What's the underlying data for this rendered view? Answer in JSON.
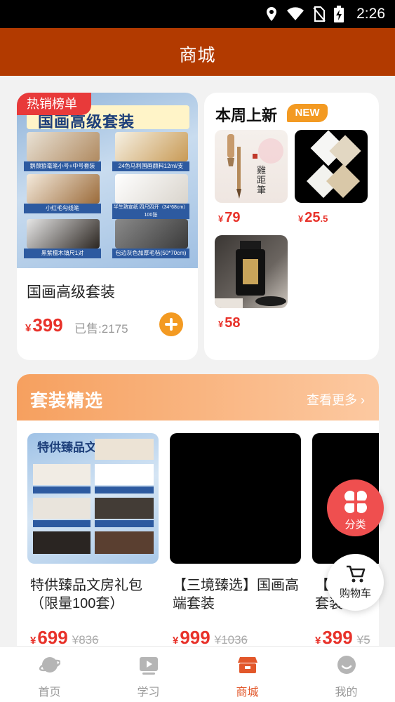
{
  "status_bar": {
    "time": "2:26"
  },
  "header": {
    "title": "商城"
  },
  "hot_card": {
    "badge": "热销榜单",
    "image_banner": "国画高级套装",
    "image_captions": [
      "鹅颈狼毫笔小号+中号套装",
      "24色马利国画颜料12ml/支",
      "小红毛勾线笔",
      "半生熟宣纸 四尺四开（34*68cm）100张",
      "黑紫檀木镇尺1对",
      "包边灰色加厚毛毡(50*70cm)"
    ],
    "name": "国画高级套装",
    "currency": "¥",
    "price": "399",
    "sold": "已售:2175"
  },
  "new_card": {
    "title": "本周上新",
    "badge": "NEW",
    "items": [
      {
        "currency": "¥",
        "price": "79",
        "decimal": ""
      },
      {
        "currency": "¥",
        "price": "25",
        "decimal": ".5"
      },
      {
        "currency": "¥",
        "price": "58",
        "decimal": ""
      }
    ]
  },
  "combo": {
    "title": "套装精选",
    "more": "查看更多",
    "products": [
      {
        "name": "特供臻品文房礼包（限量100套）",
        "currency": "¥",
        "price": "699",
        "original": "¥836",
        "image_title": "特供臻品文房礼包"
      },
      {
        "name": "【三境臻选】国画高端套装",
        "currency": "¥",
        "price": "999",
        "original": "¥1036"
      },
      {
        "name": "【",
        "name_line2": "套装",
        "currency": "¥",
        "price": "399",
        "original": "¥5"
      }
    ]
  },
  "fab": {
    "category": "分类",
    "cart": "购物车"
  },
  "bottom_nav": {
    "items": [
      {
        "label": "首页",
        "icon": "planet-icon"
      },
      {
        "label": "学习",
        "icon": "play-icon"
      },
      {
        "label": "商城",
        "icon": "shop-icon",
        "active": true
      },
      {
        "label": "我的",
        "icon": "user-icon"
      }
    ]
  },
  "colors": {
    "header": "#b23a00",
    "price": "#e8322a",
    "accent": "#f39a22",
    "active_nav": "#e2572a"
  }
}
